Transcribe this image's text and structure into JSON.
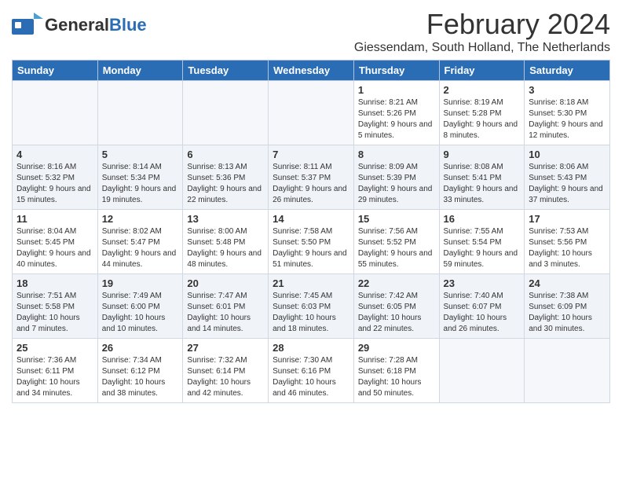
{
  "header": {
    "logo_general": "General",
    "logo_blue": "Blue",
    "month_year": "February 2024",
    "location": "Giessendam, South Holland, The Netherlands"
  },
  "days_of_week": [
    "Sunday",
    "Monday",
    "Tuesday",
    "Wednesday",
    "Thursday",
    "Friday",
    "Saturday"
  ],
  "weeks": [
    {
      "days": [
        {
          "num": "",
          "info": ""
        },
        {
          "num": "",
          "info": ""
        },
        {
          "num": "",
          "info": ""
        },
        {
          "num": "",
          "info": ""
        },
        {
          "num": "1",
          "info": "Sunrise: 8:21 AM\nSunset: 5:26 PM\nDaylight: 9 hours\nand 5 minutes."
        },
        {
          "num": "2",
          "info": "Sunrise: 8:19 AM\nSunset: 5:28 PM\nDaylight: 9 hours\nand 8 minutes."
        },
        {
          "num": "3",
          "info": "Sunrise: 8:18 AM\nSunset: 5:30 PM\nDaylight: 9 hours\nand 12 minutes."
        }
      ]
    },
    {
      "days": [
        {
          "num": "4",
          "info": "Sunrise: 8:16 AM\nSunset: 5:32 PM\nDaylight: 9 hours\nand 15 minutes."
        },
        {
          "num": "5",
          "info": "Sunrise: 8:14 AM\nSunset: 5:34 PM\nDaylight: 9 hours\nand 19 minutes."
        },
        {
          "num": "6",
          "info": "Sunrise: 8:13 AM\nSunset: 5:36 PM\nDaylight: 9 hours\nand 22 minutes."
        },
        {
          "num": "7",
          "info": "Sunrise: 8:11 AM\nSunset: 5:37 PM\nDaylight: 9 hours\nand 26 minutes."
        },
        {
          "num": "8",
          "info": "Sunrise: 8:09 AM\nSunset: 5:39 PM\nDaylight: 9 hours\nand 29 minutes."
        },
        {
          "num": "9",
          "info": "Sunrise: 8:08 AM\nSunset: 5:41 PM\nDaylight: 9 hours\nand 33 minutes."
        },
        {
          "num": "10",
          "info": "Sunrise: 8:06 AM\nSunset: 5:43 PM\nDaylight: 9 hours\nand 37 minutes."
        }
      ]
    },
    {
      "days": [
        {
          "num": "11",
          "info": "Sunrise: 8:04 AM\nSunset: 5:45 PM\nDaylight: 9 hours\nand 40 minutes."
        },
        {
          "num": "12",
          "info": "Sunrise: 8:02 AM\nSunset: 5:47 PM\nDaylight: 9 hours\nand 44 minutes."
        },
        {
          "num": "13",
          "info": "Sunrise: 8:00 AM\nSunset: 5:48 PM\nDaylight: 9 hours\nand 48 minutes."
        },
        {
          "num": "14",
          "info": "Sunrise: 7:58 AM\nSunset: 5:50 PM\nDaylight: 9 hours\nand 51 minutes."
        },
        {
          "num": "15",
          "info": "Sunrise: 7:56 AM\nSunset: 5:52 PM\nDaylight: 9 hours\nand 55 minutes."
        },
        {
          "num": "16",
          "info": "Sunrise: 7:55 AM\nSunset: 5:54 PM\nDaylight: 9 hours\nand 59 minutes."
        },
        {
          "num": "17",
          "info": "Sunrise: 7:53 AM\nSunset: 5:56 PM\nDaylight: 10 hours\nand 3 minutes."
        }
      ]
    },
    {
      "days": [
        {
          "num": "18",
          "info": "Sunrise: 7:51 AM\nSunset: 5:58 PM\nDaylight: 10 hours\nand 7 minutes."
        },
        {
          "num": "19",
          "info": "Sunrise: 7:49 AM\nSunset: 6:00 PM\nDaylight: 10 hours\nand 10 minutes."
        },
        {
          "num": "20",
          "info": "Sunrise: 7:47 AM\nSunset: 6:01 PM\nDaylight: 10 hours\nand 14 minutes."
        },
        {
          "num": "21",
          "info": "Sunrise: 7:45 AM\nSunset: 6:03 PM\nDaylight: 10 hours\nand 18 minutes."
        },
        {
          "num": "22",
          "info": "Sunrise: 7:42 AM\nSunset: 6:05 PM\nDaylight: 10 hours\nand 22 minutes."
        },
        {
          "num": "23",
          "info": "Sunrise: 7:40 AM\nSunset: 6:07 PM\nDaylight: 10 hours\nand 26 minutes."
        },
        {
          "num": "24",
          "info": "Sunrise: 7:38 AM\nSunset: 6:09 PM\nDaylight: 10 hours\nand 30 minutes."
        }
      ]
    },
    {
      "days": [
        {
          "num": "25",
          "info": "Sunrise: 7:36 AM\nSunset: 6:11 PM\nDaylight: 10 hours\nand 34 minutes."
        },
        {
          "num": "26",
          "info": "Sunrise: 7:34 AM\nSunset: 6:12 PM\nDaylight: 10 hours\nand 38 minutes."
        },
        {
          "num": "27",
          "info": "Sunrise: 7:32 AM\nSunset: 6:14 PM\nDaylight: 10 hours\nand 42 minutes."
        },
        {
          "num": "28",
          "info": "Sunrise: 7:30 AM\nSunset: 6:16 PM\nDaylight: 10 hours\nand 46 minutes."
        },
        {
          "num": "29",
          "info": "Sunrise: 7:28 AM\nSunset: 6:18 PM\nDaylight: 10 hours\nand 50 minutes."
        },
        {
          "num": "",
          "info": ""
        },
        {
          "num": "",
          "info": ""
        }
      ]
    }
  ]
}
